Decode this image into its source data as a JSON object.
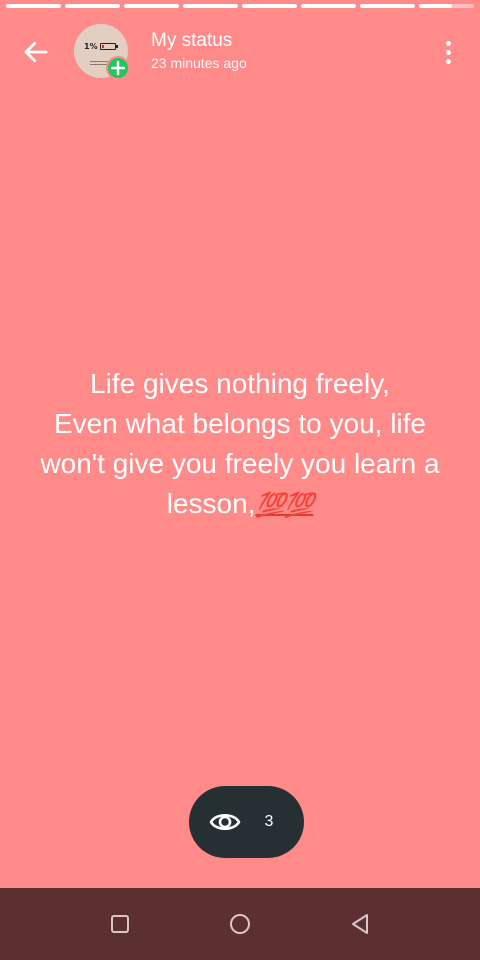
{
  "colors": {
    "background": "#FF8A8A",
    "pill": "#263033",
    "navbar": "#5C3030",
    "badge": "#22C55E",
    "emoji": "#E53935"
  },
  "progress": [
    1,
    1,
    1,
    1,
    1,
    1,
    1,
    0.6
  ],
  "header": {
    "title": "My status",
    "timestamp": "23 minutes ago",
    "back_icon": "arrow-left-icon",
    "menu_icon": "more-vertical-icon",
    "avatar": {
      "battery_text": "1%",
      "badge_icon": "plus-icon"
    }
  },
  "status": {
    "line1": "Life gives nothing freely,",
    "line2": "Even what belongs to you, life won't give you freely you learn a lesson,",
    "emoji": "💯💯"
  },
  "views": {
    "icon": "eye-icon",
    "count": "3"
  },
  "navbar": {
    "recent_icon": "square-icon",
    "home_icon": "circle-icon",
    "back_icon": "triangle-back-icon"
  }
}
